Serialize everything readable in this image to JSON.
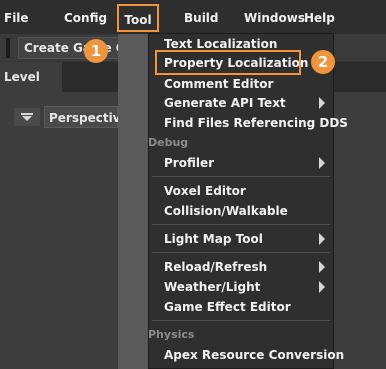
{
  "menubar": {
    "items": [
      "File",
      "Config",
      "Tool",
      "Build",
      "Windows",
      "Help"
    ]
  },
  "toolbar": {
    "create_label": "Create Game Object"
  },
  "panel": {
    "level_tab": "Level",
    "perspective_label": "Perspective"
  },
  "dropdown": {
    "items": [
      "Text Localization",
      "Property Localization",
      "Comment Editor",
      "Generate API Text",
      "Find Files Referencing DDS",
      "Profiler",
      "Voxel Editor",
      "Collision/Walkable",
      "Light Map Tool",
      "Reload/Refresh",
      "Weather/Light",
      "Game Effect Editor",
      "Apex Resource Conversion"
    ],
    "sections": [
      "Debug",
      "Physics"
    ]
  },
  "callouts": [
    "1",
    "2"
  ],
  "colors": {
    "callout_accent": "#f0953b",
    "menu_background": "#2f2f2f",
    "text": "#f2f2f2"
  },
  "icons": [
    "dropdown-triangle-icon",
    "submenu-arrow-icon"
  ]
}
